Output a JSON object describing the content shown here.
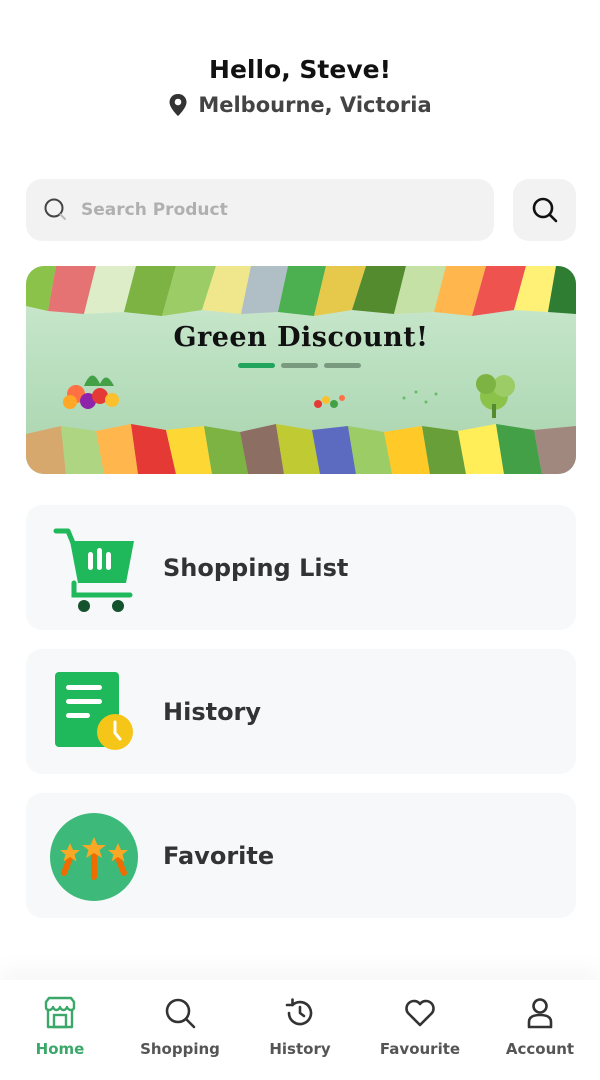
{
  "header": {
    "greeting": "Hello, Steve!",
    "location": "Melbourne, Victoria",
    "location_icon": "map-pin-icon"
  },
  "search": {
    "placeholder": "Search Product",
    "icon": "search-icon",
    "button_icon": "search-icon"
  },
  "banner": {
    "title": "Green Discount!",
    "dots_count": 3,
    "active_dot": 0
  },
  "menu": [
    {
      "label": "Shopping List",
      "icon": "shopping-cart-icon"
    },
    {
      "label": "History",
      "icon": "history-document-icon"
    },
    {
      "label": "Favorite",
      "icon": "stars-icon"
    }
  ],
  "bottom_nav": [
    {
      "label": "Home",
      "icon": "home-icon",
      "active": true
    },
    {
      "label": "Shopping",
      "icon": "search-icon",
      "active": false
    },
    {
      "label": "History",
      "icon": "history-icon",
      "active": false
    },
    {
      "label": "Favourite",
      "icon": "heart-icon",
      "active": false
    },
    {
      "label": "Account",
      "icon": "user-icon",
      "active": false
    }
  ],
  "colors": {
    "accent": "#22c55e",
    "active_nav": "#3ba86a",
    "card_bg": "#f6f8f9",
    "clock_yellow": "#f5c518"
  }
}
